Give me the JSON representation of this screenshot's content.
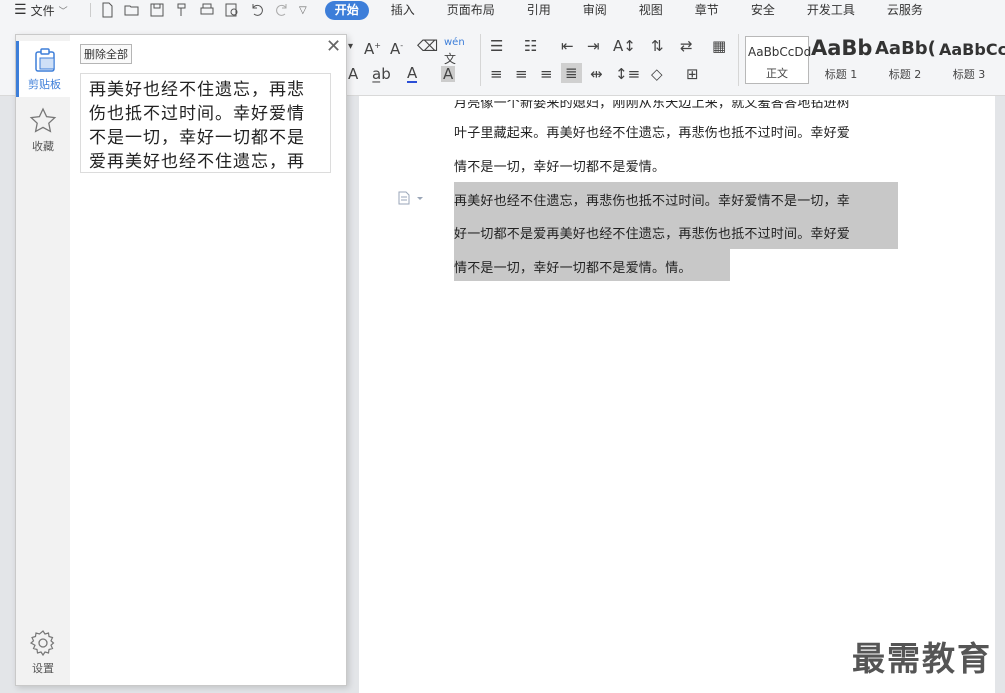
{
  "menu": {
    "file_label": "文件",
    "tabs": [
      "开始",
      "插入",
      "页面布局",
      "引用",
      "审阅",
      "视图",
      "章节",
      "安全",
      "开发工具",
      "云服务"
    ]
  },
  "ribbon": {
    "styles": [
      {
        "preview": "AaBbCcDd",
        "name": "正文"
      },
      {
        "preview": "AaBb",
        "name": "标题 1"
      },
      {
        "preview": "AaBb(",
        "name": "标题 2"
      },
      {
        "preview": "AaBbCc",
        "name": "标题 3"
      }
    ],
    "pinyin_label": "wén"
  },
  "clipboard_panel": {
    "delete_all_label": "删除全部",
    "side_items": [
      "剪贴板",
      "收藏",
      "设置"
    ],
    "clip_items": [
      "再美好也经不住遗忘，再悲伤也抵不过时间。幸好爱情不是一切，幸好一切都不是爱再美好也经不住遗忘，再悲伤也抵不过时间。"
    ]
  },
  "document": {
    "lines": [
      "月亮像一个新娶来的媳妇，刚刚从东天边上来，就又羞答答地钻进树",
      "叶子里藏起来。再美好也经不住遗忘，再悲伤也抵不过时间。幸好爱",
      "情不是一切，幸好一切都不是爱情。",
      "再美好也经不住遗忘，再悲伤也抵不过时间。幸好爱情不是一切，幸",
      "好一切都不是爱再美好也经不住遗忘，再悲伤也抵不过时间。幸好爱",
      "情不是一切，幸好一切都不是爱情。情。"
    ]
  },
  "watermark": "最需教育",
  "colors": {
    "accent": "#3d7ed9",
    "selection": "#c8c8c8"
  }
}
